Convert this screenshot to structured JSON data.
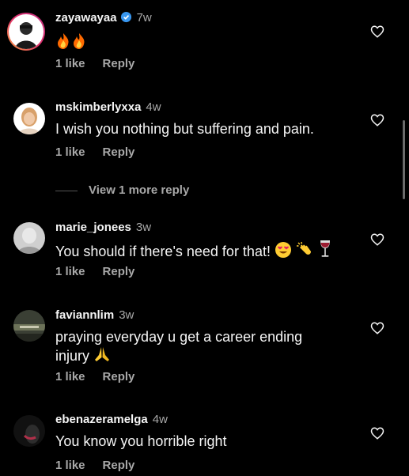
{
  "comments": [
    {
      "user": "zayawayaa",
      "time": "7w",
      "text": "",
      "likes": "1 like",
      "reply": "Reply"
    },
    {
      "user": "mskimberlyxxa",
      "time": "4w",
      "text": "I wish you nothing but suffering and pain.",
      "likes": "1 like",
      "reply": "Reply"
    },
    {
      "user": "marie_jonees",
      "time": "3w",
      "text": "You should if there's need for that!",
      "likes": "1 like",
      "reply": "Reply"
    },
    {
      "user": "faviannlim",
      "time": "3w",
      "text": "praying everyday u get a career ending injury",
      "likes": "1 like",
      "reply": "Reply"
    },
    {
      "user": "ebenazeramelga",
      "time": "4w",
      "text": "You know you horrible right",
      "likes": "1 like",
      "reply": "Reply"
    }
  ],
  "view_more": "View 1 more reply",
  "colors": {
    "background": "#000000",
    "text": "#f5f5f5",
    "muted": "#a8a8a8",
    "verified": "#3897f0"
  }
}
